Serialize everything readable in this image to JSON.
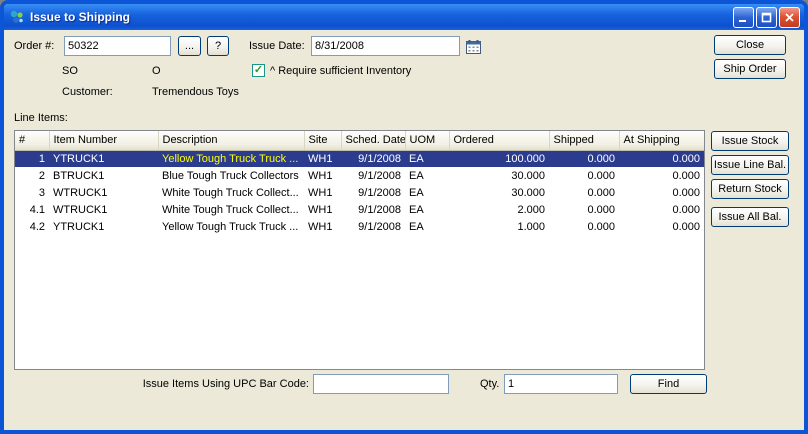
{
  "window": {
    "title": "Issue to Shipping"
  },
  "colors": {
    "frame": "#0C55D6",
    "dialog_bg": "#ECE9D8",
    "selection_bg": "#2B3C8E",
    "link_blue": "#0000C8",
    "selected_desc": "#FFFF00"
  },
  "header": {
    "order_label": "Order #:",
    "order_value": "50322",
    "ellipsis_button": "...",
    "help_button": "?",
    "issue_date_label": "Issue Date:",
    "issue_date_value": "8/31/2008",
    "so_label": "SO",
    "order_status": "O",
    "require_inventory_label": "^ Require sufficient Inventory",
    "require_inventory_checked": "checked",
    "check_glyph": "✓",
    "customer_label": "Customer:",
    "customer_value": "Tremendous Toys",
    "close_button": "Close",
    "ship_order_button": "Ship Order"
  },
  "line_items": {
    "label": "Line Items:",
    "columns": [
      "#",
      "Item Number",
      "Description",
      "Site",
      "Sched. Date",
      "UOM",
      "Ordered",
      "Shipped",
      "At Shipping"
    ],
    "rows": [
      {
        "num": "1",
        "item": "YTRUCK1",
        "desc": "Yellow Tough Truck Truck ...",
        "site": "WH1",
        "date": "9/1/2008",
        "uom": "EA",
        "ordered": "100.000",
        "shipped": "0.000",
        "at_shipping": "0.000",
        "selected": true
      },
      {
        "num": "2",
        "item": "BTRUCK1",
        "desc": "Blue Tough Truck Collectors",
        "site": "WH1",
        "date": "9/1/2008",
        "uom": "EA",
        "ordered": "30.000",
        "shipped": "0.000",
        "at_shipping": "0.000",
        "selected": false
      },
      {
        "num": "3",
        "item": "WTRUCK1",
        "desc": "White Tough Truck Collect...",
        "site": "WH1",
        "date": "9/1/2008",
        "uom": "EA",
        "ordered": "30.000",
        "shipped": "0.000",
        "at_shipping": "0.000",
        "selected": false
      },
      {
        "num": "4.1",
        "item": "WTRUCK1",
        "desc": "White Tough Truck Collect...",
        "site": "WH1",
        "date": "9/1/2008",
        "uom": "EA",
        "ordered": "2.000",
        "shipped": "0.000",
        "at_shipping": "0.000",
        "selected": false
      },
      {
        "num": "4.2",
        "item": "YTRUCK1",
        "desc": "Yellow Tough Truck Truck ...",
        "site": "WH1",
        "date": "9/1/2008",
        "uom": "EA",
        "ordered": "1.000",
        "shipped": "0.000",
        "at_shipping": "0.000",
        "selected": false
      }
    ]
  },
  "side_buttons": [
    "Issue Stock",
    "Issue Line Bal.",
    "Return Stock",
    "Issue All Bal."
  ],
  "footer": {
    "upc_label": "Issue Items Using UPC Bar Code:",
    "upc_value": "",
    "qty_label": "Qty.",
    "qty_value": "1",
    "find_button": "Find"
  }
}
